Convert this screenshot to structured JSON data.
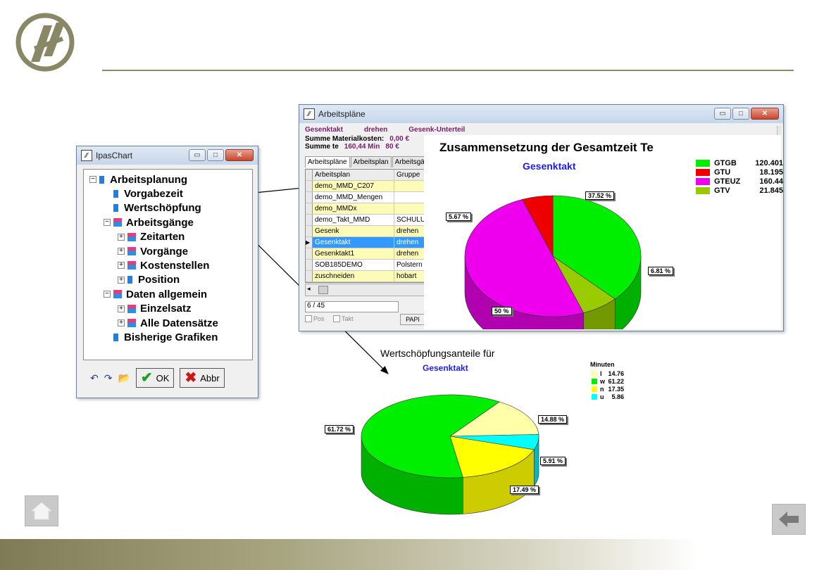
{
  "slide": {
    "nav": {
      "home_icon": "home-icon",
      "back_icon": "arrow-left-icon"
    }
  },
  "ipaschart": {
    "title": "IpasChart",
    "tree": [
      {
        "label": "Arbeitsplanung",
        "toggle": "−",
        "icon": "blue"
      },
      {
        "label": "Vorgabezeit",
        "icon": "blue"
      },
      {
        "label": "Wertschöpfung",
        "icon": "blue"
      },
      {
        "label": "Arbeitsgänge",
        "toggle": "−",
        "icon": "folder"
      },
      {
        "label": "Zeitarten",
        "toggle": "+",
        "icon": "folder"
      },
      {
        "label": "Vorgänge",
        "toggle": "+",
        "icon": "folder"
      },
      {
        "label": "Kostenstellen",
        "toggle": "+",
        "icon": "folder"
      },
      {
        "label": "Position",
        "toggle": "+",
        "icon": "blue"
      },
      {
        "label": "Daten allgemein",
        "toggle": "−",
        "icon": "folder"
      },
      {
        "label": "Einzelsatz",
        "toggle": "+",
        "icon": "folder"
      },
      {
        "label": "Alle Datensätze",
        "toggle": "+",
        "icon": "folder"
      },
      {
        "label": "Bisherige Grafiken",
        "icon": "blue"
      }
    ],
    "ok_label": "OK",
    "abbr_label": "Abbr"
  },
  "arbeitsplaene": {
    "title": "Arbeitspläne",
    "info1": "Gesenktakt",
    "info1b": "drehen",
    "info1c": "Gesenk-Unterteil",
    "mat_label": "Summe Materialkosten:",
    "mat_value": "0,00 €",
    "te_label": "Summe te",
    "te_value": "160,44 Min",
    "te_cost": "80 €",
    "tabs": [
      "Arbeitspläne",
      "Arbeitsplan",
      "Arbeitsgänge"
    ],
    "col1": "Arbeitsplan",
    "col2": "Gruppe",
    "rows": [
      {
        "c1": "demo_MMD_C207",
        "c2": "",
        "style": "yel"
      },
      {
        "c1": "demo_MMD_Mengen",
        "c2": "",
        "style": ""
      },
      {
        "c1": "demo_MMDx",
        "c2": "",
        "style": "yel"
      },
      {
        "c1": "demo_Takt_MMD",
        "c2": "SCHULUN",
        "style": ""
      },
      {
        "c1": "Gesenk",
        "c2": "drehen",
        "style": "yel"
      },
      {
        "c1": "Gesenktakt",
        "c2": "drehen",
        "style": "sel"
      },
      {
        "c1": "Gesenktakt1",
        "c2": "drehen",
        "style": "yel"
      },
      {
        "c1": "SOB185DEMO",
        "c2": "Polstern",
        "style": ""
      },
      {
        "c1": "zuschneiden",
        "c2": "hobart",
        "style": "yel"
      }
    ],
    "record": "6 / 45",
    "pos_label": "Pos",
    "takt_label": "Takt",
    "pap_label": "PAPI"
  },
  "chart_data": [
    {
      "type": "pie",
      "title": "Zusammensetzung der Gesamtzeit Te",
      "subtitle": "Gesenktakt",
      "slices": [
        {
          "name": "GTGB",
          "value": 120.401,
          "pct_label": "37.52 %",
          "color": "#00ee00",
          "side": "#00b000"
        },
        {
          "name": "GTU",
          "value": 18.195,
          "pct_label": "5.67 %",
          "color": "#ee0000",
          "side": "#a80000"
        },
        {
          "name": "GTEUZ",
          "value": 160.44,
          "pct_label": "50 %",
          "color": "#ee00ee",
          "side": "#b000b0"
        },
        {
          "name": "GTV",
          "value": 21.845,
          "pct_label": "6.81 %",
          "color": "#99cc00",
          "side": "#739900"
        }
      ],
      "legend": "top-right"
    },
    {
      "type": "pie",
      "title": "Wertschöpfungsanteile für",
      "subtitle": "Gesenktakt",
      "legend_title": "Minuten",
      "slices": [
        {
          "name": "l",
          "value": 14.76,
          "value_label": "14.76",
          "pct_label": "14.88 %",
          "color": "#ffffaa",
          "side": "#d4d488"
        },
        {
          "name": "w",
          "value": 61.22,
          "value_label": "61.22",
          "pct_label": "61.72 %",
          "color": "#00ee00",
          "side": "#00b000"
        },
        {
          "name": "n",
          "value": 17.35,
          "value_label": "17.35",
          "pct_label": "17.49 %",
          "color": "#ffff00",
          "side": "#cccc00"
        },
        {
          "name": "u",
          "value": 5.86,
          "value_label": "5.86",
          "pct_label": "5.91 %",
          "color": "#00ffff",
          "side": "#00bbbb"
        }
      ],
      "legend": "top-right"
    }
  ]
}
